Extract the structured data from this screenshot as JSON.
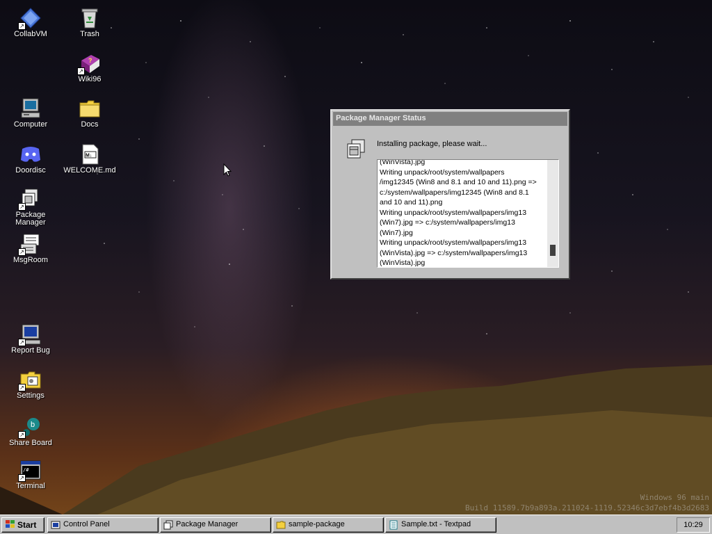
{
  "desktop": {
    "icons": [
      {
        "label": "CollabVM",
        "icon": "collabvm-diamond-icon"
      },
      {
        "label": "Trash",
        "icon": "recycle-bin-icon"
      },
      {
        "label": "Wiki96",
        "icon": "help-book-icon"
      },
      {
        "label": "Computer",
        "icon": "computer-icon"
      },
      {
        "label": "Docs",
        "icon": "folder-icon"
      },
      {
        "label": "Doordisc",
        "icon": "discord-icon"
      },
      {
        "label": "WELCOME.md",
        "icon": "markdown-file-icon"
      },
      {
        "label": "Package Manager",
        "icon": "package-manager-icon"
      },
      {
        "label": "MsgRoom",
        "icon": "msgroom-icon"
      },
      {
        "label": "Report Bug",
        "icon": "report-bug-icon"
      },
      {
        "label": "Settings",
        "icon": "settings-folder-icon"
      },
      {
        "label": "Share Board",
        "icon": "share-board-icon"
      },
      {
        "label": "Terminal",
        "icon": "terminal-icon"
      }
    ]
  },
  "dialog": {
    "title": "Package Manager Status",
    "status": "Installing package, please wait...",
    "log": [
      "(WinVista).jpg",
      "Writing unpack/root/system/wallpapers",
      "/img12345 (Win8 and 8.1 and 10 and 11).png =>",
      "c:/system/wallpapers/img12345 (Win8 and 8.1",
      "and 10 and 11).png",
      "Writing unpack/root/system/wallpapers/img13",
      "(Win7).jpg => c:/system/wallpapers/img13",
      "(Win7).jpg",
      "Writing unpack/root/system/wallpapers/img13",
      "(WinVista).jpg => c:/system/wallpapers/img13",
      "(WinVista).jpg"
    ]
  },
  "watermark": {
    "line1": "Windows 96 main",
    "line2": "Build 11589.7b9a893a.211024-1119.52346c3d7ebf4b3d2683"
  },
  "taskbar": {
    "start_label": "Start",
    "tasks": [
      {
        "label": "Control Panel",
        "icon": "control-panel-icon"
      },
      {
        "label": "Package Manager",
        "icon": "package-icon"
      },
      {
        "label": "sample-package",
        "icon": "folder-icon"
      },
      {
        "label": "Sample.txt - Textpad",
        "icon": "textpad-icon"
      }
    ],
    "clock": "10:29"
  },
  "colors": {
    "window_face": "#c0c0c0",
    "titlebar_inactive": "#808080",
    "icon_folder": "#f4d03f"
  }
}
